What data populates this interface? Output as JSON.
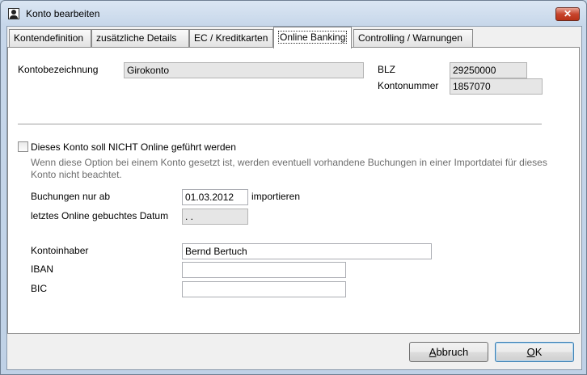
{
  "window": {
    "title": "Konto bearbeiten"
  },
  "tabs": [
    {
      "label": "Kontendefinition"
    },
    {
      "label": "zusätzliche Details"
    },
    {
      "label": "EC / Kreditkarten"
    },
    {
      "label": "Online Banking"
    },
    {
      "label": "Controlling / Warnungen"
    }
  ],
  "active_tab": "Online Banking",
  "account": {
    "name_label": "Kontobezeichnung",
    "name_value": "Girokonto",
    "blz_label": "BLZ",
    "blz_value": "29250000",
    "number_label": "Kontonummer",
    "number_value": "1857070"
  },
  "online": {
    "checkbox_label": "Dieses Konto soll NICHT Online geführt werden",
    "checked": false,
    "hint": "Wenn diese Option bei einem Konto gesetzt ist, werden eventuell vorhandene Buchungen in einer Importdatei für dieses Konto nicht beachtet.",
    "import_from_label": "Buchungen nur ab",
    "import_from_value": "01.03.2012",
    "import_suffix": "importieren",
    "last_date_label": "letztes Online gebuchtes Datum",
    "last_date_value": " . ."
  },
  "holder": {
    "owner_label": "Kontoinhaber",
    "owner_value": "Bernd Bertuch",
    "iban_label": "IBAN",
    "iban_value": "",
    "bic_label": "BIC",
    "bic_value": ""
  },
  "buttons": {
    "cancel_mnemonic": "A",
    "cancel_rest": "bbruch",
    "ok_mnemonic": "O",
    "ok_rest": "K"
  },
  "icons": {
    "app": "user-icon",
    "close": "close-icon"
  },
  "colors": {
    "close_button": "#c7442c",
    "readonly_field": "#e6e6e6"
  }
}
